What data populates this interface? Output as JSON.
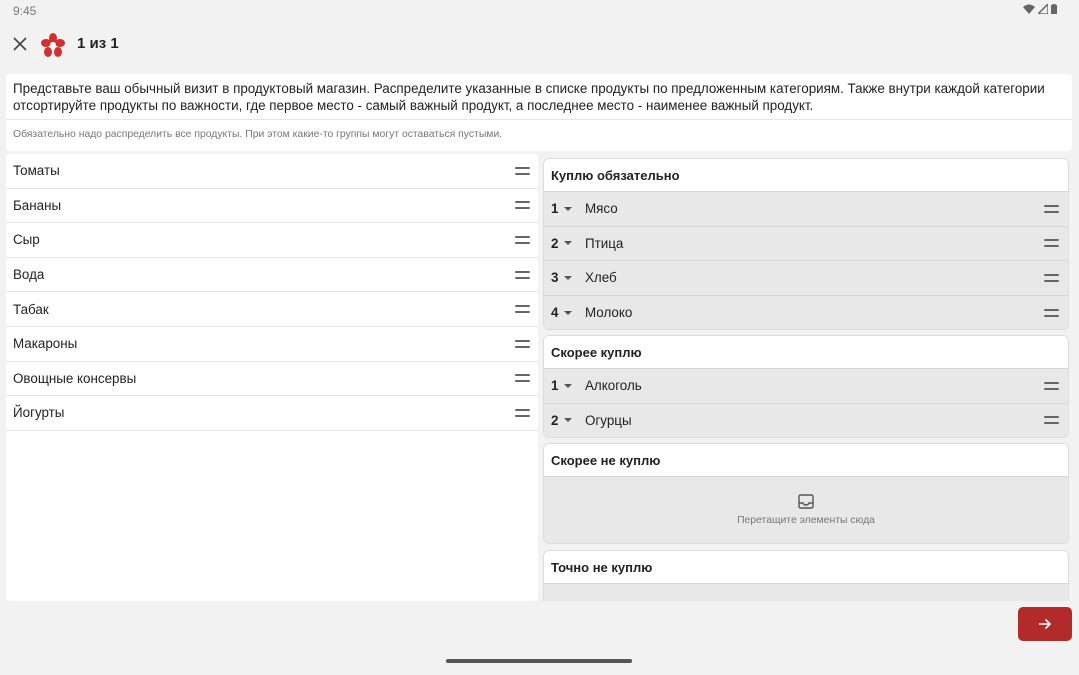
{
  "status": {
    "time": "9:45"
  },
  "header": {
    "title": "1 из 1"
  },
  "instructions": {
    "main": "Представьте ваш обычный визит в продуктовый магазин. Распределите указанные в списке продукты по предложенным категориям. Также внутри каждой категории отсортируйте продукты по важности, где первое место - самый важный продукт, а последнее место - наименее важный продукт.",
    "note": "Обязательно надо распределить все продукты. При этом какие-то группы могут оставаться пустыми."
  },
  "unsorted_items": [
    "Томаты",
    "Бананы",
    "Сыр",
    "Вода",
    "Табак",
    "Макароны",
    "Овощные консервы",
    "Йогурты"
  ],
  "groups": [
    {
      "title": "Куплю обязательно",
      "items": [
        {
          "rank": "1",
          "name": "Мясо"
        },
        {
          "rank": "2",
          "name": "Птица"
        },
        {
          "rank": "3",
          "name": "Хлеб"
        },
        {
          "rank": "4",
          "name": "Молоко"
        }
      ]
    },
    {
      "title": "Скорее куплю",
      "items": [
        {
          "rank": "1",
          "name": "Алкоголь"
        },
        {
          "rank": "2",
          "name": "Огурцы"
        }
      ]
    },
    {
      "title": "Скорее не куплю",
      "empty_text": "Перетащите элементы сюда"
    },
    {
      "title": "Точно не куплю"
    }
  ],
  "colors": {
    "accent": "#b32a2a",
    "logo": "#d32f2f"
  },
  "icons": {
    "close": "close-icon",
    "logo": "flower-logo-icon",
    "drag": "drag-handle-icon",
    "inbox": "inbox-icon",
    "next": "arrow-right-icon"
  }
}
